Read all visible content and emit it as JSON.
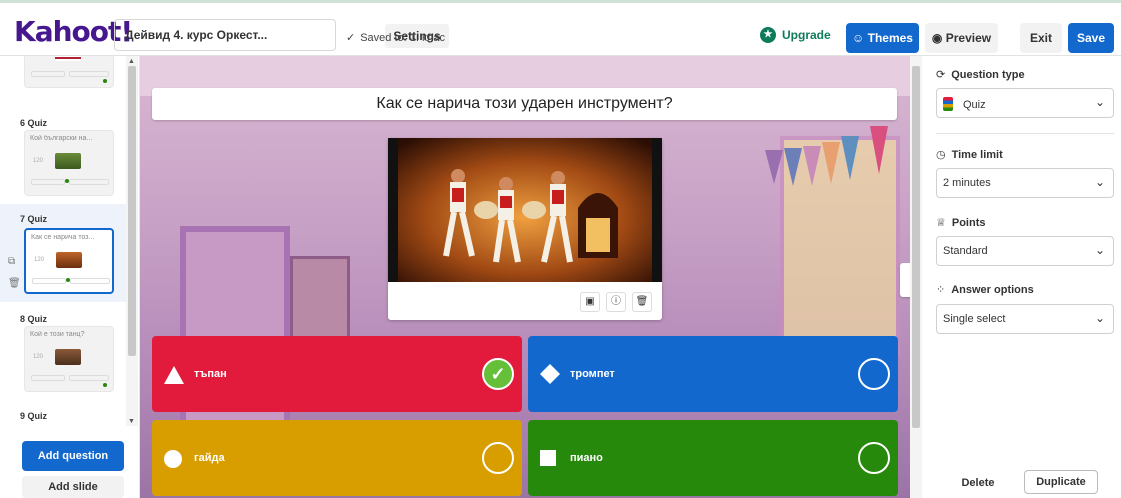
{
  "app": {
    "logo": "Kahoot!"
  },
  "header": {
    "title": "Дейвид 4. курс Оркест...",
    "settings_label": "Settings",
    "saved_label": "Saved to:",
    "saved_folder": "1. клас",
    "upgrade_label": "Upgrade",
    "themes_label": "Themes",
    "preview_label": "Preview",
    "exit_label": "Exit",
    "save_label": "Save"
  },
  "sidebar": {
    "slides": [
      {
        "label": "",
        "question": "",
        "num": "120",
        "thumb": "flag"
      },
      {
        "label": "6  Quiz",
        "question": "Кой български на...",
        "num": "120",
        "thumb": "landscape"
      },
      {
        "label": "7  Quiz",
        "question": "Как се нарича тоз...",
        "num": "120",
        "thumb": "dancers",
        "active": true
      },
      {
        "label": "8  Quiz",
        "question": "Кой е този танц?",
        "num": "120",
        "thumb": "dance"
      },
      {
        "label": "9  Quiz",
        "question": "",
        "num": "",
        "thumb": ""
      }
    ],
    "add_question_label": "Add question",
    "add_slide_label": "Add slide"
  },
  "canvas": {
    "question": "Как се нарича този ударен инструмент?",
    "answers": [
      {
        "text": "тъпан",
        "color": "#e21b3c",
        "shape": "triangle",
        "correct": true
      },
      {
        "text": "тромпет",
        "color": "#1368ce",
        "shape": "diamond",
        "correct": false
      },
      {
        "text": "гайда",
        "color": "#d89e00",
        "shape": "circle",
        "correct": false
      },
      {
        "text": "пиано",
        "color": "#26890c",
        "shape": "square",
        "correct": false
      }
    ]
  },
  "right_panel": {
    "question_type_label": "Question type",
    "question_type_value": "Quiz",
    "time_limit_label": "Time limit",
    "time_limit_value": "2 minutes",
    "points_label": "Points",
    "points_value": "Standard",
    "answer_options_label": "Answer options",
    "answer_options_value": "Single select",
    "delete_label": "Delete",
    "duplicate_label": "Duplicate"
  }
}
